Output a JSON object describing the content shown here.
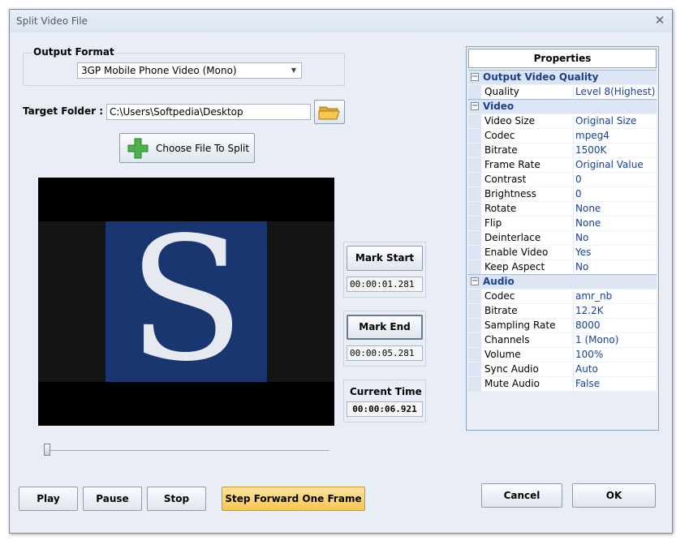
{
  "window": {
    "title": "Split Video File",
    "close_glyph": "✕"
  },
  "output_format": {
    "label": "Output Format",
    "selected": "3GP Mobile Phone Video (Mono)"
  },
  "target_folder": {
    "label": "Target Folder :",
    "value": "C:\\Users\\Softpedia\\Desktop",
    "browse_icon": "folder-open-icon"
  },
  "choose_file": {
    "label": "Choose File To Split",
    "icon": "plus-icon"
  },
  "preview": {
    "glyph": "S"
  },
  "mark_start": {
    "label": "Mark Start",
    "time": "00:00:01.281"
  },
  "mark_end": {
    "label": "Mark End",
    "time": "00:00:05.281"
  },
  "current_time": {
    "label": "Current Time",
    "time": "00:00:06.921"
  },
  "slider": {
    "position": 0.0
  },
  "controls": {
    "play": "Play",
    "pause": "Pause",
    "stop": "Stop",
    "step": "Step Forward One Frame"
  },
  "dialog": {
    "cancel": "Cancel",
    "ok": "OK"
  },
  "properties": {
    "title": "Properties",
    "categories": [
      {
        "name": "Output Video Quality",
        "rows": [
          {
            "name": "Quality",
            "value": "Level 8(Highest)"
          }
        ]
      },
      {
        "name": "Video",
        "rows": [
          {
            "name": "Video Size",
            "value": "Original Size"
          },
          {
            "name": "Codec",
            "value": "mpeg4"
          },
          {
            "name": "Bitrate",
            "value": "1500K"
          },
          {
            "name": "Frame Rate",
            "value": "Original Value"
          },
          {
            "name": "Contrast",
            "value": "0"
          },
          {
            "name": "Brightness",
            "value": "0"
          },
          {
            "name": "Rotate",
            "value": "None"
          },
          {
            "name": "Flip",
            "value": "None"
          },
          {
            "name": "Deinterlace",
            "value": "No"
          },
          {
            "name": "Enable Video",
            "value": "Yes"
          },
          {
            "name": "Keep Aspect",
            "value": "No"
          }
        ]
      },
      {
        "name": "Audio",
        "rows": [
          {
            "name": "Codec",
            "value": "amr_nb"
          },
          {
            "name": "Bitrate",
            "value": "12.2K"
          },
          {
            "name": "Sampling Rate",
            "value": "8000"
          },
          {
            "name": "Channels",
            "value": "1 (Mono)"
          },
          {
            "name": "Volume",
            "value": "100%"
          },
          {
            "name": "Sync Audio",
            "value": "Auto"
          },
          {
            "name": "Mute Audio",
            "value": "False"
          }
        ]
      }
    ]
  }
}
